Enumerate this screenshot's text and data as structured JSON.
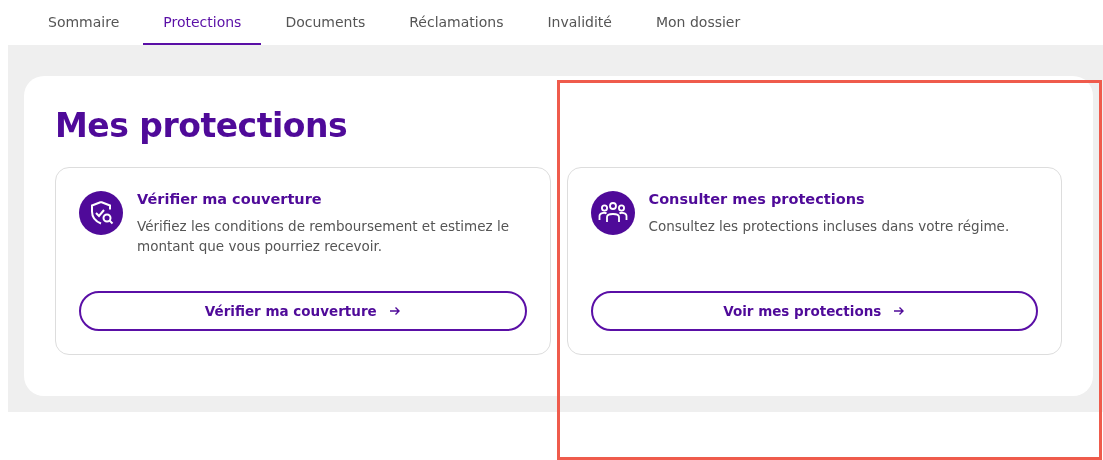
{
  "tabs": [
    {
      "label": "Sommaire",
      "selected": false
    },
    {
      "label": "Protections",
      "selected": true
    },
    {
      "label": "Documents",
      "selected": false
    },
    {
      "label": "Réclamations",
      "selected": false
    },
    {
      "label": "Invalidité",
      "selected": false
    },
    {
      "label": "Mon dossier",
      "selected": false
    }
  ],
  "page_title": "Mes protections",
  "cards": [
    {
      "kind": "shield",
      "title": "Vérifier ma couverture",
      "description": "Vérifiez les conditions de remboursement et estimez le montant que vous pourriez recevoir.",
      "button": "Vérifier ma couverture"
    },
    {
      "kind": "people",
      "title": "Consulter mes protections",
      "description": "Consultez les protections incluses dans votre régime.",
      "button": "Voir mes protections"
    }
  ],
  "highlight_box": true
}
